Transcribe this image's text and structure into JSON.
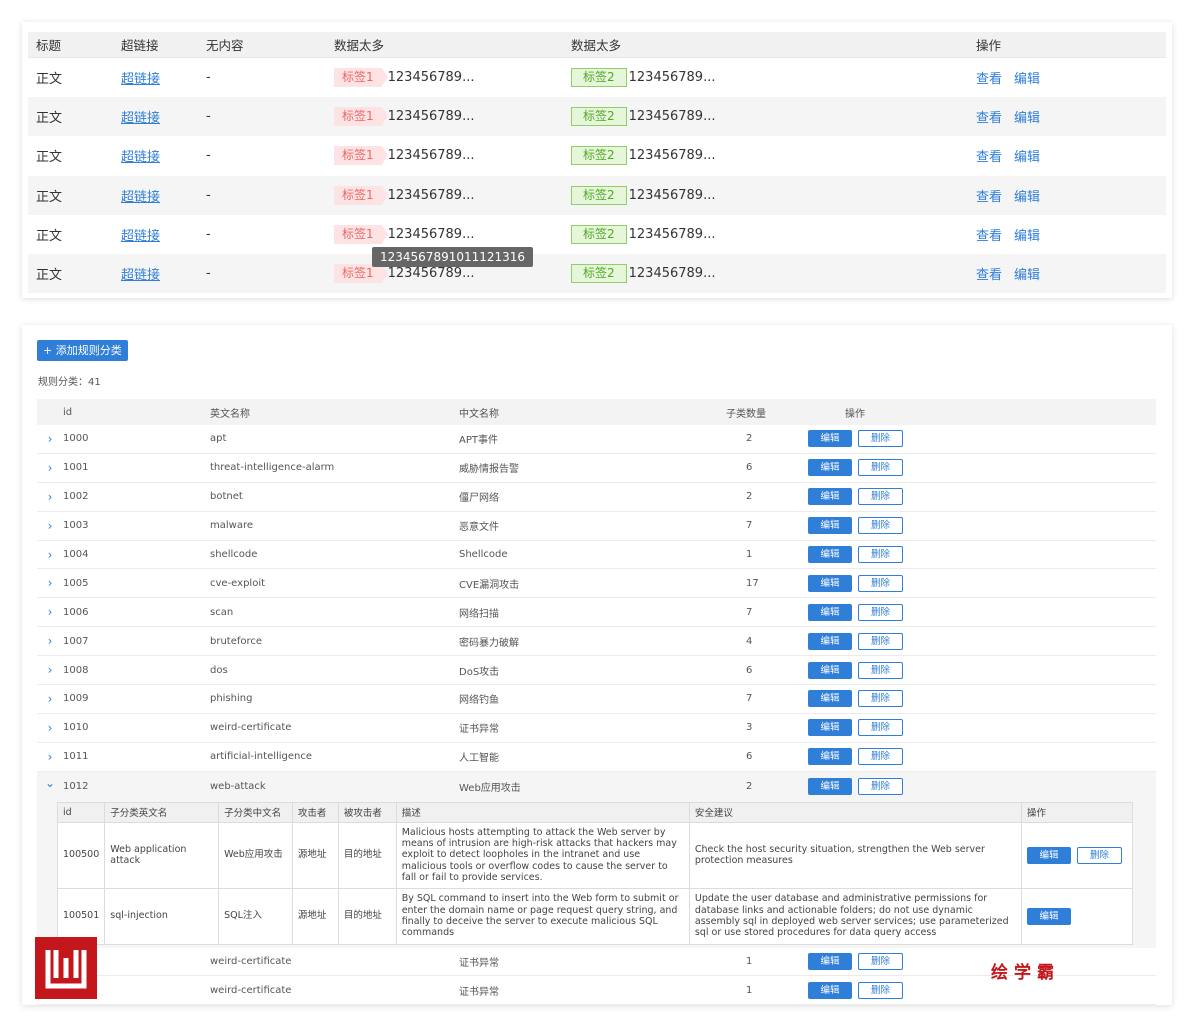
{
  "table1": {
    "headers": [
      "标题",
      "超链接",
      "无内容",
      "数据太多",
      "数据太多",
      "操作"
    ],
    "rows": [
      {
        "title": "正文",
        "link": "超链接",
        "empty": "-",
        "tag1": "标签1",
        "text1": "123456789...",
        "tag2": "标签2",
        "text2": "123456789...",
        "view": "查看",
        "edit": "编辑"
      },
      {
        "title": "正文",
        "link": "超链接",
        "empty": "-",
        "tag1": "标签1",
        "text1": "123456789...",
        "tag2": "标签2",
        "text2": "123456789...",
        "view": "查看",
        "edit": "编辑"
      },
      {
        "title": "正文",
        "link": "超链接",
        "empty": "-",
        "tag1": "标签1",
        "text1": "123456789...",
        "tag2": "标签2",
        "text2": "123456789...",
        "view": "查看",
        "edit": "编辑"
      },
      {
        "title": "正文",
        "link": "超链接",
        "empty": "-",
        "tag1": "标签1",
        "text1": "123456789...",
        "tag2": "标签2",
        "text2": "123456789...",
        "view": "查看",
        "edit": "编辑"
      },
      {
        "title": "正文",
        "link": "超链接",
        "empty": "-",
        "tag1": "标签1",
        "text1": "123456789...",
        "tag2": "标签2",
        "text2": "123456789...",
        "view": "查看",
        "edit": "编辑"
      },
      {
        "title": "正文",
        "link": "超链接",
        "empty": "-",
        "tag1": "标签1",
        "text1": "123456789...",
        "tag2": "标签2",
        "text2": "123456789...",
        "view": "查看",
        "edit": "编辑"
      }
    ],
    "tooltip": "1234567891011121316"
  },
  "panel2": {
    "add_button": "+ 添加规则分类",
    "count_label": "规则分类：41",
    "headers": [
      "id",
      "英文名称",
      "中文名称",
      "子类数量",
      "操作"
    ],
    "edit_label": "编辑",
    "delete_label": "删除",
    "rows": [
      {
        "id": "1000",
        "en": "apt",
        "cn": "APT事件",
        "num": "2"
      },
      {
        "id": "1001",
        "en": "threat-intelligence-alarm",
        "cn": "威胁情报告警",
        "num": "6"
      },
      {
        "id": "1002",
        "en": "botnet",
        "cn": "僵尸网络",
        "num": "2"
      },
      {
        "id": "1003",
        "en": "malware",
        "cn": "恶意文件",
        "num": "7"
      },
      {
        "id": "1004",
        "en": "shellcode",
        "cn": "Shellcode",
        "num": "1"
      },
      {
        "id": "1005",
        "en": "cve-exploit",
        "cn": "CVE漏洞攻击",
        "num": "17"
      },
      {
        "id": "1006",
        "en": "scan",
        "cn": "网络扫描",
        "num": "7"
      },
      {
        "id": "1007",
        "en": "bruteforce",
        "cn": "密码暴力破解",
        "num": "4"
      },
      {
        "id": "1008",
        "en": "dos",
        "cn": "DoS攻击",
        "num": "6"
      },
      {
        "id": "1009",
        "en": "phishing",
        "cn": "网络钓鱼",
        "num": "7"
      },
      {
        "id": "1010",
        "en": "weird-certificate",
        "cn": "证书异常",
        "num": "3"
      },
      {
        "id": "1011",
        "en": "artificial-intelligence",
        "cn": "人工智能",
        "num": "6"
      },
      {
        "id": "1012",
        "en": "web-attack",
        "cn": "Web应用攻击",
        "num": "2"
      }
    ],
    "sub_headers": [
      "id",
      "子分类英文名",
      "子分类中文名",
      "攻击者",
      "被攻击者",
      "描述",
      "安全建议",
      "操作"
    ],
    "sub_rows": [
      {
        "id": "100500",
        "en": "Web application attack",
        "cn": "Web应用攻击",
        "attacker": "源地址",
        "victim": "目的地址",
        "desc": "Malicious hosts attempting to attack the Web server by means of intrusion are high-risk attacks that hackers may exploit to detect loopholes in the intranet and use malicious tools or overflow codes to cause the server to fall or fail to provide services.",
        "advice": "Check the host security situation, strengthen the Web server protection measures"
      },
      {
        "id": "100501",
        "en": "sql-injection",
        "cn": "SQL注入",
        "attacker": "源地址",
        "victim": "目的地址",
        "desc": "By SQL command to insert into the Web form to submit or enter the domain name or page request query string, and finally to deceive the server to execute malicious SQL commands",
        "advice": "Update the user database and administrative permissions for database links and actionable folders; do not use dynamic assembly sql in deployed web server services; use parameterized sql or use stored procedures for data query access"
      }
    ],
    "tail_rows": [
      {
        "en": "weird-certificate",
        "cn": "证书异常",
        "num": "1"
      },
      {
        "en": "weird-certificate",
        "cn": "证书异常",
        "num": "1"
      }
    ]
  },
  "watermark": {
    "brand": "绘学霸"
  }
}
